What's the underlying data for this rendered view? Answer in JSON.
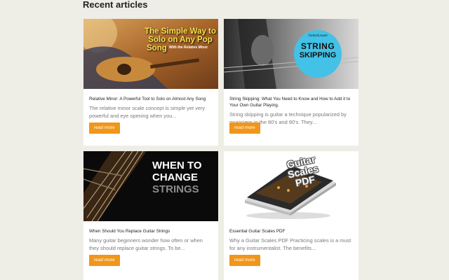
{
  "section": {
    "heading": "Recent articles"
  },
  "articles": [
    {
      "title": "Relative Minor: A Powerful Tool to Solo on Almost Any Song",
      "excerpt": "The relative minor scale concept is simple yet very powerful and eye opening when you...",
      "button": "read more",
      "image": {
        "line1": "The Simple Way to",
        "line2": "Solo on Any Pop",
        "line3": "Song",
        "sub": "With the Relative Minor",
        "accent": "#f7e14a"
      }
    },
    {
      "title": "String Skipping: What You Need to Know and How to Add it to Your Own Guitar Playing.",
      "excerpt": "String skipping is guitar a technique popularized by musicians in the 80's and 90's. They...",
      "button": "read more",
      "image": {
        "logo": "GuitarLesson",
        "line1": "STRING",
        "line2": "SKIPPING",
        "accent": "#43c1e6"
      }
    },
    {
      "title": "When Should You Replace Guitar Strings",
      "excerpt": "Many guitar beginners wonder how often or when they should replace guitar strings. To be...",
      "button": "read more",
      "image": {
        "line1": "WHEN TO",
        "line2": "CHANGE",
        "line3": "STRINGS"
      }
    },
    {
      "title": "Essential Guitar Scales PDF",
      "excerpt": "Why a Guitar Scales PDF Practicing scales is a must for any instrumentalist. The benefits...",
      "button": "read more",
      "image": {
        "line1": "Guitar",
        "line2": "Scales",
        "line3": "PDF"
      }
    }
  ]
}
